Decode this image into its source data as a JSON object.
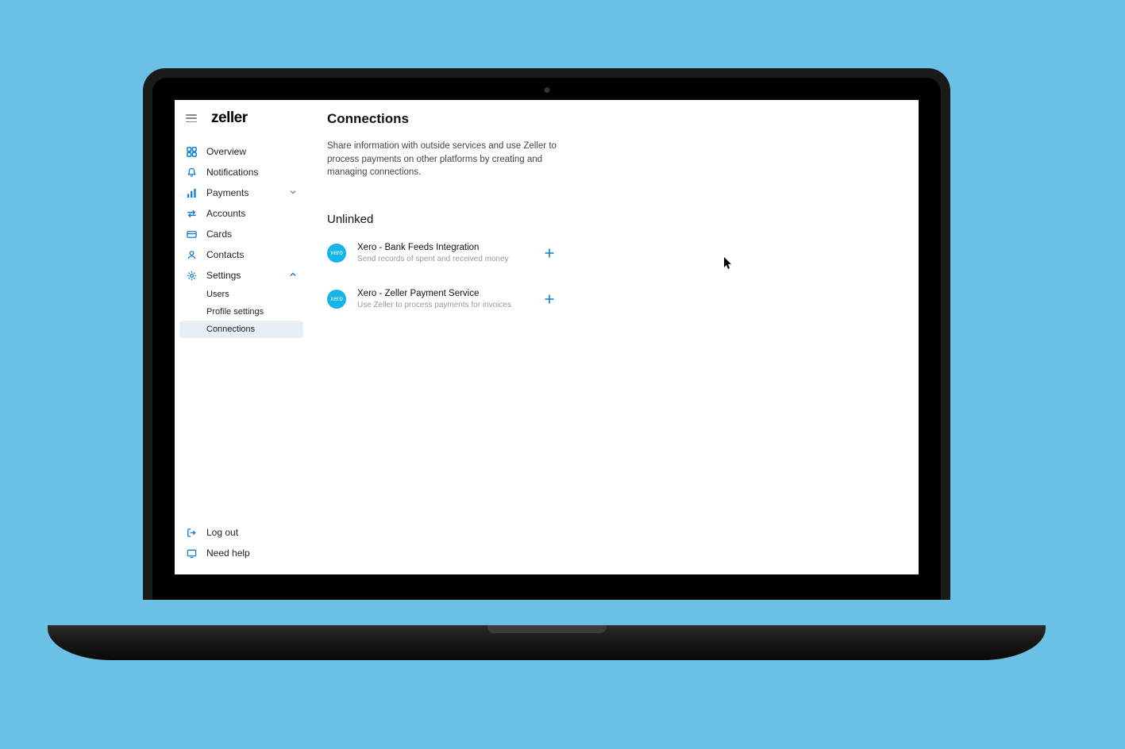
{
  "brand": {
    "logo": "zeller"
  },
  "sidebar": {
    "items": [
      {
        "label": "Overview"
      },
      {
        "label": "Notifications"
      },
      {
        "label": "Payments"
      },
      {
        "label": "Accounts"
      },
      {
        "label": "Cards"
      },
      {
        "label": "Contacts"
      },
      {
        "label": "Settings"
      }
    ],
    "sub": [
      {
        "label": "Users"
      },
      {
        "label": "Profile settings"
      },
      {
        "label": "Connections"
      }
    ],
    "bottom": [
      {
        "label": "Log out"
      },
      {
        "label": "Need help"
      }
    ]
  },
  "page": {
    "title": "Connections",
    "description": "Share information with outside services and use Zeller to process payments on other platforms by creating and managing connections.",
    "section": "Unlinked"
  },
  "connections": [
    {
      "logo_text": "xero",
      "title": "Xero - Bank Feeds Integration",
      "subtitle": "Send records of spent and received money"
    },
    {
      "logo_text": "xero",
      "title": "Xero - Zeller Payment Service",
      "subtitle": "Use Zeller to process payments for invoices"
    }
  ],
  "colors": {
    "accent": "#0B7ED8",
    "xero": "#13B5EA",
    "bg": "#6BC1E5"
  }
}
